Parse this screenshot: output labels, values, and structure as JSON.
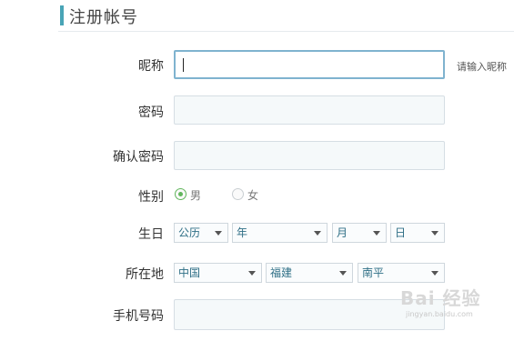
{
  "header": {
    "title": "注册帐号"
  },
  "form": {
    "nickname": {
      "label": "昵称",
      "value": "",
      "hint": "请输入昵称"
    },
    "password": {
      "label": "密码",
      "value": ""
    },
    "confirm_password": {
      "label": "确认密码",
      "value": ""
    },
    "gender": {
      "label": "性别",
      "options": [
        {
          "label": "男",
          "checked": true
        },
        {
          "label": "女",
          "checked": false
        }
      ]
    },
    "birthday": {
      "label": "生日",
      "calendar": "公历",
      "year": "年",
      "month": "月",
      "day": "日"
    },
    "location": {
      "label": "所在地",
      "country": "中国",
      "province": "福建",
      "city": "南平"
    },
    "phone": {
      "label": "手机号码",
      "value": ""
    }
  },
  "watermark": {
    "main": "Bai 经验",
    "sub": "jingyan.baidu.com"
  },
  "colors": {
    "accent": "#49a4b6",
    "radio_checked": "#62b65d",
    "focus_border": "#7fb3cf"
  }
}
